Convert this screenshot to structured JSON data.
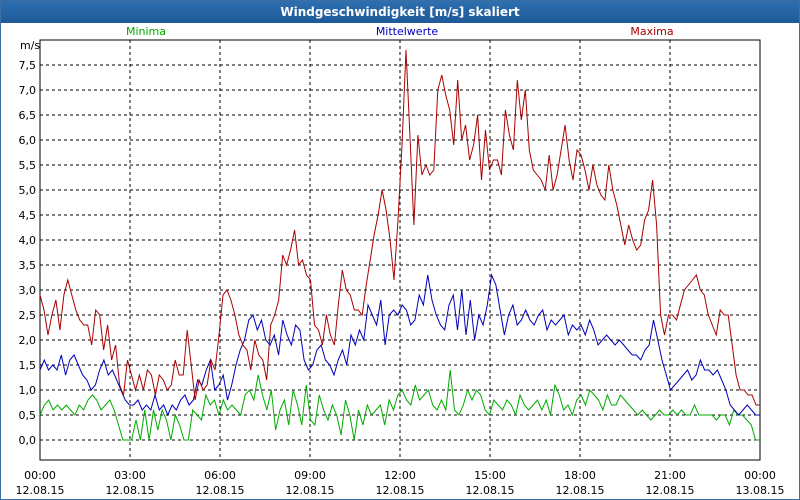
{
  "window": {
    "title": "Windgeschwindigkeit [m/s] skaliert"
  },
  "chart_data": {
    "type": "line",
    "title": "Windgeschwindigkeit [m/s] skaliert",
    "ylabel": "m/s",
    "ylim": [
      -0.4,
      8.0
    ],
    "xlim_hours": [
      0,
      24
    ],
    "grid": true,
    "y_ticks": [
      "0,0",
      "0,5",
      "1,0",
      "1,5",
      "2,0",
      "2,5",
      "3,0",
      "3,5",
      "4,0",
      "4,5",
      "5,0",
      "5,5",
      "6,0",
      "6,5",
      "7,0",
      "7,5"
    ],
    "x_ticks": [
      {
        "time": "00:00",
        "date": "12.08.15"
      },
      {
        "time": "03:00",
        "date": "12.08.15"
      },
      {
        "time": "06:00",
        "date": "12.08.15"
      },
      {
        "time": "09:00",
        "date": "12.08.15"
      },
      {
        "time": "12:00",
        "date": "12.08.15"
      },
      {
        "time": "15:00",
        "date": "12.08.15"
      },
      {
        "time": "18:00",
        "date": "12.08.15"
      },
      {
        "time": "21:00",
        "date": "12.08.15"
      },
      {
        "time": "00:00",
        "date": "13.08.15"
      }
    ],
    "legend_placement": "top",
    "series": [
      {
        "name": "Minima",
        "color": "#00aa00",
        "values": [
          0.5,
          0.7,
          0.8,
          0.6,
          0.7,
          0.6,
          0.7,
          0.6,
          0.5,
          0.7,
          0.6,
          0.8,
          0.9,
          0.8,
          0.6,
          0.7,
          0.8,
          0.6,
          0.3,
          0.0,
          0.0,
          0.0,
          0.4,
          0.0,
          0.6,
          0.0,
          0.6,
          0.2,
          0.6,
          0.4,
          0.0,
          0.5,
          0.3,
          0.0,
          0.0,
          0.6,
          0.5,
          0.4,
          0.9,
          0.7,
          0.8,
          0.5,
          0.8,
          0.6,
          0.7,
          0.6,
          0.5,
          0.9,
          1.0,
          0.8,
          1.3,
          0.9,
          0.6,
          1.0,
          0.2,
          0.6,
          0.8,
          0.3,
          1.0,
          0.7,
          0.3,
          1.1,
          0.4,
          0.3,
          0.9,
          0.6,
          0.4,
          0.7,
          0.5,
          0.1,
          0.8,
          0.5,
          0.0,
          0.6,
          0.3,
          0.7,
          0.5,
          0.6,
          0.7,
          0.3,
          0.8,
          0.6,
          0.9,
          1.0,
          0.8,
          0.7,
          1.1,
          0.8,
          0.9,
          1.0,
          0.7,
          0.6,
          0.8,
          0.6,
          1.4,
          0.6,
          0.5,
          0.7,
          1.0,
          0.8,
          1.0,
          0.9,
          0.6,
          0.5,
          0.8,
          0.7,
          0.6,
          0.8,
          0.7,
          0.5,
          0.9,
          0.7,
          0.6,
          0.7,
          0.8,
          0.6,
          0.8,
          0.5,
          1.1,
          0.9,
          0.6,
          0.7,
          0.5,
          0.8,
          0.9,
          0.7,
          1.0,
          0.9,
          0.8,
          0.6,
          0.9,
          0.7,
          0.7,
          0.9,
          0.8,
          0.7,
          0.6,
          0.5,
          0.6,
          0.5,
          0.4,
          0.5,
          0.6,
          0.5,
          0.5,
          0.6,
          0.5,
          0.6,
          0.5,
          0.5,
          0.7,
          0.5,
          0.5,
          0.5,
          0.5,
          0.4,
          0.5,
          0.5,
          0.3,
          0.6,
          0.5,
          0.5,
          0.4,
          0.3,
          0.0,
          0.0
        ]
      },
      {
        "name": "Mittelwerte",
        "color": "#0000bb",
        "values": [
          1.4,
          1.6,
          1.4,
          1.5,
          1.4,
          1.7,
          1.3,
          1.6,
          1.7,
          1.5,
          1.3,
          1.2,
          1.0,
          1.1,
          1.4,
          1.6,
          1.3,
          1.4,
          1.2,
          1.0,
          0.8,
          0.7,
          0.7,
          0.8,
          0.6,
          0.7,
          0.6,
          0.9,
          0.6,
          0.7,
          0.5,
          0.7,
          0.6,
          0.8,
          0.9,
          0.7,
          0.8,
          1.2,
          1.1,
          1.4,
          1.6,
          1.0,
          1.1,
          1.3,
          0.8,
          1.1,
          1.5,
          1.8,
          2.0,
          2.4,
          2.5,
          2.2,
          2.4,
          2.0,
          1.9,
          2.1,
          1.7,
          2.4,
          2.1,
          1.9,
          2.3,
          2.2,
          1.6,
          1.4,
          1.5,
          1.8,
          1.9,
          1.6,
          1.5,
          1.3,
          1.6,
          1.8,
          1.5,
          2.1,
          1.9,
          2.2,
          2.0,
          2.7,
          2.5,
          2.3,
          2.8,
          1.9,
          2.5,
          2.6,
          2.5,
          2.7,
          2.6,
          2.3,
          2.4,
          2.9,
          2.7,
          3.3,
          2.8,
          2.5,
          2.3,
          2.2,
          2.7,
          2.9,
          2.2,
          3.0,
          2.1,
          2.8,
          2.0,
          2.5,
          2.3,
          2.7,
          3.3,
          3.1,
          2.6,
          2.1,
          2.5,
          2.7,
          2.3,
          2.4,
          2.6,
          2.4,
          2.3,
          2.5,
          2.6,
          2.2,
          2.4,
          2.3,
          2.4,
          2.5,
          2.1,
          2.3,
          2.2,
          2.3,
          2.1,
          2.4,
          2.2,
          1.9,
          2.0,
          2.1,
          2.0,
          1.9,
          2.0,
          1.9,
          1.8,
          1.7,
          1.7,
          1.6,
          1.8,
          1.9,
          2.4,
          2.0,
          1.6,
          1.3,
          1.0,
          1.1,
          1.2,
          1.3,
          1.4,
          1.2,
          1.3,
          1.6,
          1.4,
          1.4,
          1.3,
          1.4,
          1.2,
          1.0,
          0.7,
          0.6,
          0.5,
          0.6,
          0.7,
          0.6,
          0.5,
          0.5
        ]
      },
      {
        "name": "Maxima",
        "color": "#aa0000",
        "values": [
          2.9,
          2.6,
          2.1,
          2.5,
          2.8,
          2.2,
          2.9,
          3.2,
          2.9,
          2.6,
          2.4,
          2.3,
          2.3,
          1.9,
          2.6,
          2.5,
          1.8,
          2.3,
          1.6,
          1.9,
          1.1,
          0.9,
          1.6,
          1.3,
          1.0,
          1.3,
          1.0,
          1.4,
          1.3,
          0.9,
          1.3,
          1.2,
          1.0,
          1.1,
          1.6,
          1.3,
          1.3,
          2.2,
          1.5,
          0.8,
          1.2,
          1.0,
          1.1,
          1.6,
          1.4,
          2.1,
          2.9,
          3.0,
          2.8,
          2.5,
          2.1,
          1.9,
          1.8,
          1.4,
          2.0,
          1.7,
          1.6,
          1.2,
          2.3,
          2.5,
          2.8,
          3.7,
          3.5,
          3.8,
          4.2,
          3.5,
          3.6,
          3.3,
          3.2,
          2.3,
          2.2,
          1.9,
          2.5,
          2.1,
          1.9,
          2.7,
          3.4,
          3.0,
          2.9,
          2.6,
          2.6,
          2.5,
          3.1,
          3.6,
          4.1,
          4.5,
          5.0,
          4.6,
          4.0,
          3.2,
          4.4,
          5.9,
          7.8,
          6.1,
          4.3,
          6.1,
          5.3,
          5.5,
          5.3,
          5.4,
          7.0,
          7.3,
          6.9,
          6.6,
          5.9,
          7.2,
          6.0,
          6.3,
          5.6,
          5.9,
          6.5,
          5.2,
          6.2,
          5.4,
          5.6,
          5.6,
          5.3,
          6.6,
          6.1,
          5.8,
          7.2,
          6.4,
          7.0,
          5.8,
          5.4,
          5.3,
          5.2,
          5.0,
          5.7,
          5.0,
          5.3,
          5.8,
          6.3,
          5.6,
          5.2,
          5.8,
          5.7,
          5.4,
          5.0,
          5.5,
          5.1,
          4.9,
          4.8,
          5.5,
          5.0,
          4.7,
          4.3,
          3.9,
          4.3,
          4.0,
          3.8,
          3.9,
          4.4,
          4.6,
          5.2,
          4.3,
          2.5,
          2.1,
          2.5,
          2.5,
          2.4,
          2.7,
          3.0,
          3.1,
          3.2,
          3.3,
          3.0,
          2.9,
          2.5,
          2.3,
          2.1,
          2.6,
          2.5,
          2.5,
          1.9,
          1.3,
          1.0,
          1.0,
          0.9,
          0.9,
          0.7,
          0.7
        ]
      }
    ]
  }
}
